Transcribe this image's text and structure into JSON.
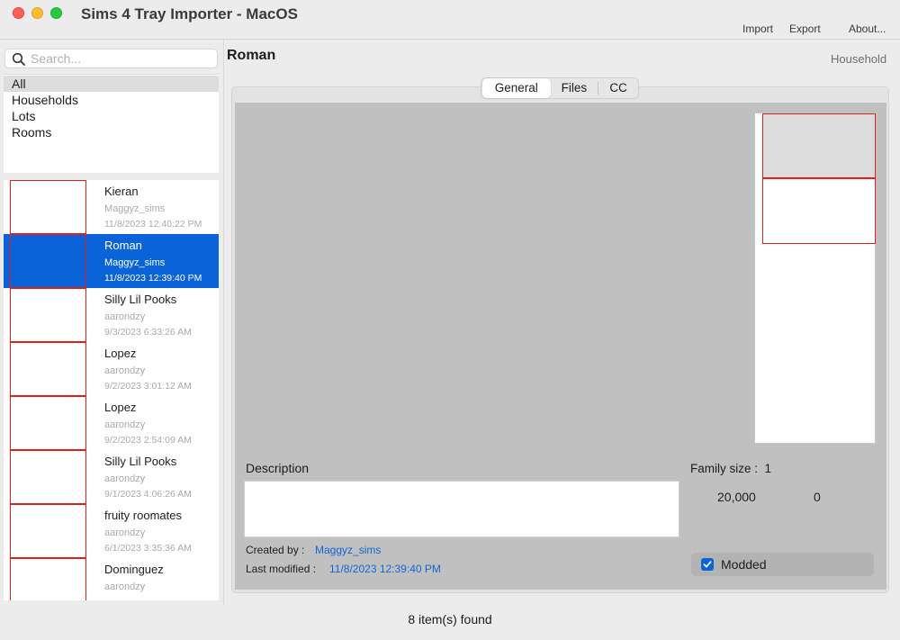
{
  "window": {
    "title": "Sims 4 Tray Importer - MacOS",
    "menu": {
      "import": "Import",
      "export": "Export",
      "about": "About..."
    }
  },
  "sidebar": {
    "search_placeholder": "Search...",
    "categories": [
      {
        "label": "All",
        "selected": true
      },
      {
        "label": "Households",
        "selected": false
      },
      {
        "label": "Lots",
        "selected": false
      },
      {
        "label": "Rooms",
        "selected": false
      }
    ],
    "items": [
      {
        "name": "Kieran",
        "author": "Maggyz_sims",
        "date": "11/8/2023 12:40:22 PM",
        "selected": false
      },
      {
        "name": "Roman",
        "author": "Maggyz_sims",
        "date": "11/8/2023 12:39:40 PM",
        "selected": true
      },
      {
        "name": "Silly Lil Pooks",
        "author": "aarondzy",
        "date": "9/3/2023 6:33:26 AM",
        "selected": false
      },
      {
        "name": "Lopez",
        "author": "aarondzy",
        "date": "9/2/2023 3:01:12 AM",
        "selected": false
      },
      {
        "name": "Lopez",
        "author": "aarondzy",
        "date": "9/2/2023 2:54:09 AM",
        "selected": false
      },
      {
        "name": "Silly Lil Pooks",
        "author": "aarondzy",
        "date": "9/1/2023 4:06:26 AM",
        "selected": false
      },
      {
        "name": "fruity roomates",
        "author": "aarondzy",
        "date": "6/1/2023 3:35:36 AM",
        "selected": false
      },
      {
        "name": "Dominguez",
        "author": "aarondzy",
        "date": "",
        "selected": false
      }
    ]
  },
  "detail": {
    "title": "Roman",
    "type": "Household",
    "tabs": [
      {
        "label": "General",
        "active": true
      },
      {
        "label": "Files",
        "active": false
      },
      {
        "label": "CC",
        "active": false
      }
    ],
    "description_label": "Description",
    "description_value": "",
    "created_by_label": "Created by :",
    "created_by_value": "Maggyz_sims",
    "last_modified_label": "Last modified :",
    "last_modified_value": "11/8/2023 12:39:40 PM",
    "family_size_label": "Family size :",
    "family_size_value": "1",
    "funds": "20,000",
    "second_stat": "0",
    "modded_label": "Modded",
    "modded_checked": true
  },
  "status": {
    "text": "8  item(s) found"
  },
  "colors": {
    "accent": "#0a63d9",
    "link": "#1166d6",
    "placeholder_border": "#e0201b",
    "content_bg": "#c0c0c0"
  }
}
